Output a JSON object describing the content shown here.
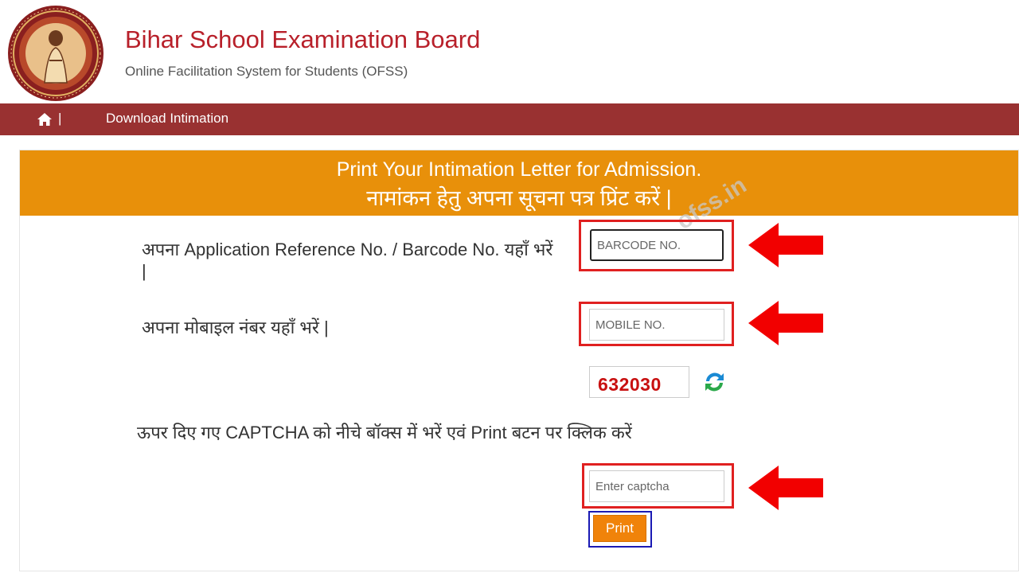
{
  "header": {
    "title": "Bihar School Examination Board",
    "subtitle": "Online Facilitation System for Students (OFSS)",
    "logo_icon": "bseb-seal-logo"
  },
  "nav": {
    "home_icon": "home-icon",
    "separator": "|",
    "items": [
      {
        "label": "Download Intimation"
      }
    ]
  },
  "panel": {
    "heading_en": "Print Your Intimation Letter for Admission.",
    "heading_hi": "नामांकन हेतु अपना सूचना पत्र प्रिंट करें |"
  },
  "watermark": "ofss.in",
  "form": {
    "ref_label": "अपना Application Reference No. / Barcode No. यहाँ भरें |",
    "ref_placeholder": "BARCODE NO.",
    "mobile_label": "अपना मोबाइल नंबर यहाँ भरें |",
    "mobile_placeholder": "MOBILE NO.",
    "captcha_code": "632030",
    "captcha_label": "ऊपर दिए गए CAPTCHA को नीचे बॉक्स में भरें एवं Print बटन पर क्लिक करें",
    "captcha_placeholder": "Enter captcha",
    "print_label": "Print",
    "refresh_icon": "refresh-icon"
  },
  "colors": {
    "brand_red": "#b8202a",
    "nav_bg": "#993131",
    "heading_bg": "#e8900a",
    "highlight_red": "#e02020",
    "print_btn": "#f0830a",
    "print_frame": "#1a1ab4",
    "captcha_text": "#c81010"
  }
}
